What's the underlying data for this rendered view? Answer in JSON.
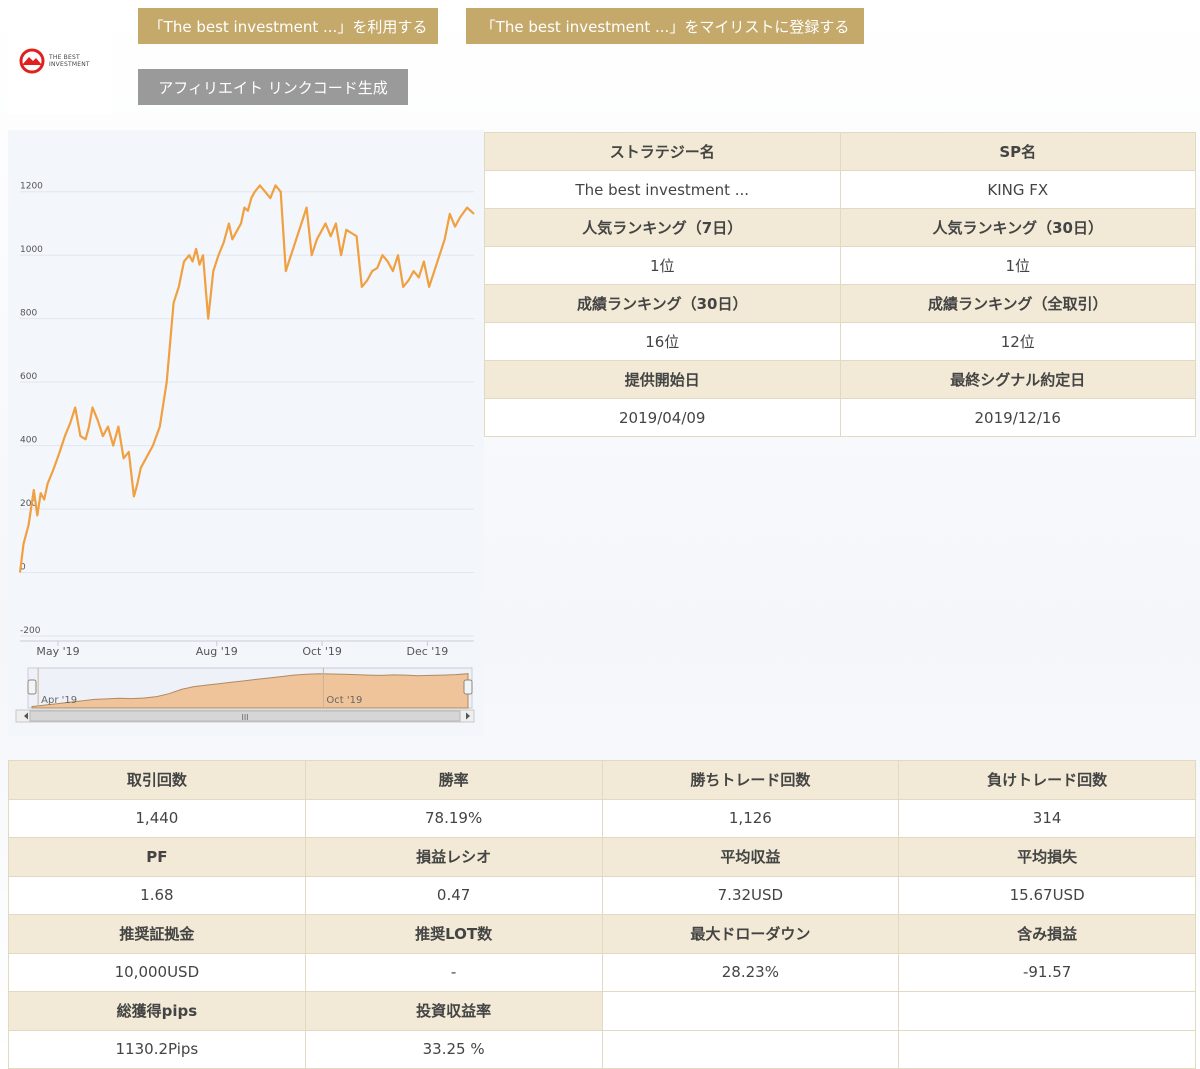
{
  "logo": {
    "text": "THE BEST INVESTMENT",
    "accent": "#e02020"
  },
  "buttons": {
    "use": "「The best investment ...」を利用する",
    "mylist": "「The best investment ...」をマイリストに登録する",
    "affiliate": "アフィリエイト リンクコード生成"
  },
  "info": {
    "strategy_name_label": "ストラテジー名",
    "sp_name_label": "SP名",
    "strategy_name": "The best investment ...",
    "sp_name": "KING FX",
    "rank7_label": "人気ランキング（7日）",
    "rank30_label": "人気ランキング（30日）",
    "rank7": "1位",
    "rank30": "1位",
    "perf30_label": "成績ランキング（30日）",
    "perf_all_label": "成績ランキング（全取引）",
    "perf30": "16位",
    "perf_all": "12位",
    "start_label": "提供開始日",
    "last_signal_label": "最終シグナル約定日",
    "start": "2019/04/09",
    "last_signal": "2019/12/16"
  },
  "stats": {
    "trades_label": "取引回数",
    "winrate_label": "勝率",
    "wins_label": "勝ちトレード回数",
    "losses_label": "負けトレード回数",
    "trades": "1,440",
    "winrate": "78.19%",
    "wins": "1,126",
    "losses": "314",
    "pf_label": "PF",
    "ratio_label": "損益レシオ",
    "avg_profit_label": "平均収益",
    "avg_loss_label": "平均損失",
    "pf": "1.68",
    "ratio": "0.47",
    "avg_profit": "7.32USD",
    "avg_loss": "15.67USD",
    "margin_label": "推奨証拠金",
    "lot_label": "推奨LOT数",
    "mdd_label": "最大ドローダウン",
    "unrealized_label": "含み損益",
    "margin": "10,000USD",
    "lot": "-",
    "mdd": "28.23%",
    "unrealized": "-91.57",
    "pips_label": "総獲得pips",
    "roi_label": "投資収益率",
    "pips": "1130.2Pips",
    "roi": "33.25 %"
  },
  "chart_data": {
    "type": "line",
    "line_color": "#f0a040",
    "navigator_fill": "#f0c49a",
    "ylim": [
      -200,
      1300
    ],
    "yticks": [
      -200,
      0,
      200,
      400,
      600,
      800,
      1000,
      1200
    ],
    "xlim": [
      "2019-04-09",
      "2019-12-28"
    ],
    "xticks": [
      {
        "label": "May '19",
        "date": "2019-05-01"
      },
      {
        "label": "Aug '19",
        "date": "2019-08-01"
      },
      {
        "label": "Oct '19",
        "date": "2019-10-01"
      },
      {
        "label": "Dec '19",
        "date": "2019-12-01"
      }
    ],
    "navigator_ticks": [
      {
        "label": "Apr '19",
        "date": "2019-04-15"
      },
      {
        "label": "Oct '19",
        "date": "2019-10-01"
      }
    ],
    "navigator_scrollbar_label": "III",
    "grid": true,
    "series": [
      {
        "x": [
          "2019-04-09",
          "2019-04-11",
          "2019-04-14",
          "2019-04-17",
          "2019-04-19",
          "2019-04-21",
          "2019-04-23",
          "2019-04-25",
          "2019-04-28",
          "2019-04-30",
          "2019-05-02",
          "2019-05-05",
          "2019-05-08",
          "2019-05-11",
          "2019-05-14",
          "2019-05-17",
          "2019-05-19",
          "2019-05-21",
          "2019-05-24",
          "2019-05-27",
          "2019-05-30",
          "2019-06-02",
          "2019-06-05",
          "2019-06-08",
          "2019-06-11",
          "2019-06-14",
          "2019-06-16",
          "2019-06-18",
          "2019-06-21",
          "2019-06-25",
          "2019-06-29",
          "2019-07-03",
          "2019-07-07",
          "2019-07-10",
          "2019-07-13",
          "2019-07-16",
          "2019-07-18",
          "2019-07-20",
          "2019-07-22",
          "2019-07-24",
          "2019-07-27",
          "2019-07-30",
          "2019-08-02",
          "2019-08-05",
          "2019-08-08",
          "2019-08-10",
          "2019-08-13",
          "2019-08-15",
          "2019-08-17",
          "2019-08-19",
          "2019-08-21",
          "2019-08-23",
          "2019-08-26",
          "2019-08-29",
          "2019-09-01",
          "2019-09-04",
          "2019-09-07",
          "2019-09-10",
          "2019-09-13",
          "2019-09-16",
          "2019-09-19",
          "2019-09-22",
          "2019-09-25",
          "2019-09-28",
          "2019-10-01",
          "2019-10-03",
          "2019-10-06",
          "2019-10-09",
          "2019-10-12",
          "2019-10-15",
          "2019-10-18",
          "2019-10-21",
          "2019-10-24",
          "2019-10-27",
          "2019-10-30",
          "2019-11-02",
          "2019-11-05",
          "2019-11-08",
          "2019-11-11",
          "2019-11-14",
          "2019-11-17",
          "2019-11-20",
          "2019-11-23",
          "2019-11-26",
          "2019-11-29",
          "2019-12-02",
          "2019-12-05",
          "2019-12-08",
          "2019-12-11",
          "2019-12-14",
          "2019-12-17",
          "2019-12-20",
          "2019-12-24",
          "2019-12-28"
        ],
        "values": [
          0,
          90,
          150,
          260,
          180,
          250,
          230,
          280,
          320,
          350,
          380,
          430,
          470,
          520,
          430,
          420,
          460,
          520,
          480,
          430,
          460,
          400,
          460,
          360,
          380,
          240,
          280,
          330,
          360,
          400,
          460,
          600,
          850,
          900,
          980,
          1000,
          980,
          1020,
          970,
          1000,
          800,
          950,
          1000,
          1040,
          1100,
          1050,
          1080,
          1100,
          1150,
          1140,
          1180,
          1200,
          1220,
          1200,
          1180,
          1220,
          1200,
          950,
          1000,
          1050,
          1100,
          1150,
          1000,
          1050,
          1080,
          1100,
          1060,
          1100,
          1000,
          1080,
          1070,
          1060,
          900,
          920,
          950,
          960,
          1000,
          980,
          950,
          1000,
          900,
          920,
          950,
          930,
          980,
          900,
          950,
          1000,
          1050,
          1130,
          1090,
          1120,
          1150,
          1130
        ],
        "navigator_values": [
          50,
          100,
          150,
          200,
          250,
          300,
          320,
          340,
          330,
          350,
          400,
          500,
          650,
          750,
          800,
          850,
          900,
          950,
          1000,
          1050,
          1100,
          1150,
          1180,
          1200,
          1190,
          1180,
          1170,
          1150,
          1140,
          1160,
          1150,
          1130,
          1140,
          1150,
          1170,
          1200
        ]
      }
    ]
  }
}
